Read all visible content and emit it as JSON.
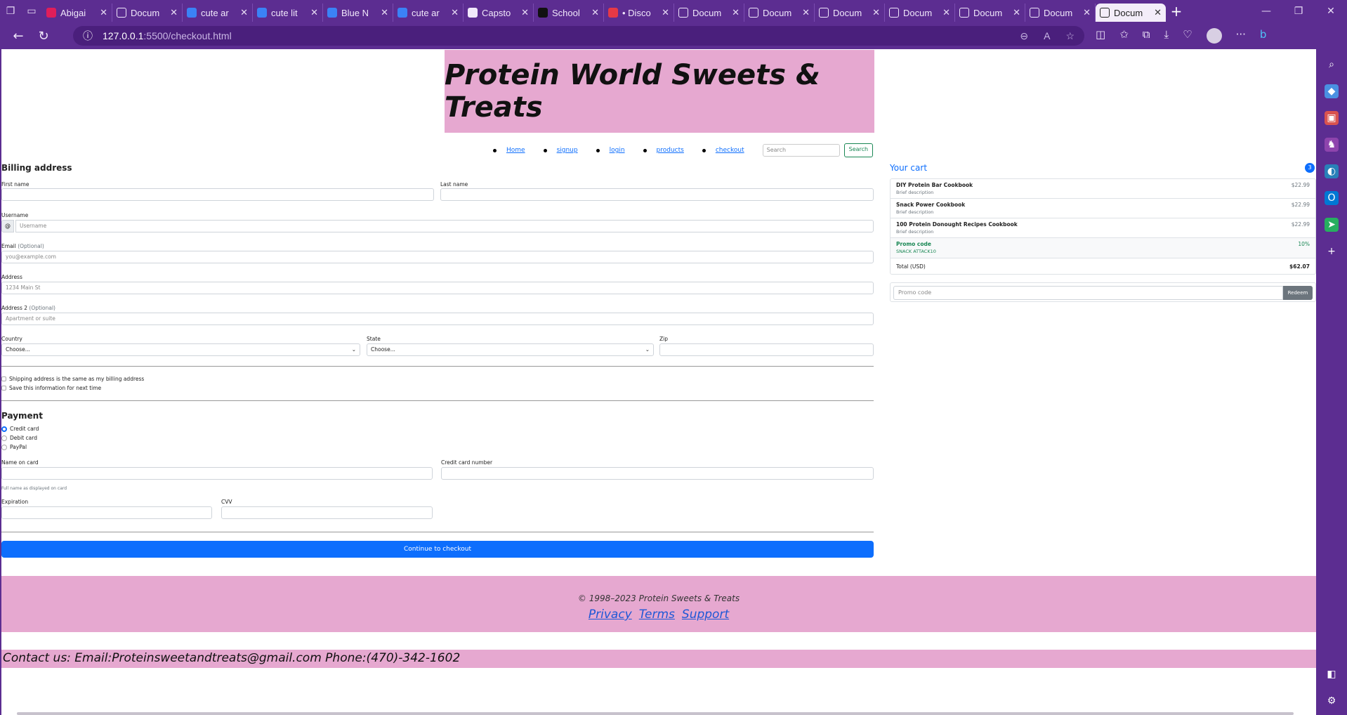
{
  "browser": {
    "tabs": [
      {
        "label": "Abigai",
        "icon": "slack-icon",
        "color": "#e01e5a"
      },
      {
        "label": "Docum",
        "icon": "document-icon",
        "color": "#f1e8fb"
      },
      {
        "label": "cute ar",
        "icon": "bing-search-icon",
        "color": "#3b82f6"
      },
      {
        "label": "cute lit",
        "icon": "bing-search-icon",
        "color": "#3b82f6"
      },
      {
        "label": "Blue N",
        "icon": "bing-search-icon",
        "color": "#3b82f6"
      },
      {
        "label": "cute ar",
        "icon": "bing-search-icon",
        "color": "#3b82f6"
      },
      {
        "label": "Capsto",
        "icon": "s-logo-icon",
        "color": "#f1e8fb"
      },
      {
        "label": "School",
        "icon": "school-icon",
        "color": "#111"
      },
      {
        "label": "• Disco",
        "icon": "discord-icon",
        "color": "#e63946"
      },
      {
        "label": "Docum",
        "icon": "document-icon",
        "color": "#f1e8fb"
      },
      {
        "label": "Docum",
        "icon": "document-icon",
        "color": "#f1e8fb"
      },
      {
        "label": "Docum",
        "icon": "document-icon",
        "color": "#f1e8fb"
      },
      {
        "label": "Docum",
        "icon": "document-icon",
        "color": "#f1e8fb"
      },
      {
        "label": "Docum",
        "icon": "document-icon",
        "color": "#f1e8fb"
      },
      {
        "label": "Docum",
        "icon": "document-icon",
        "color": "#f1e8fb"
      },
      {
        "label": "Docum",
        "icon": "document-icon",
        "color": "#222",
        "active": true
      }
    ],
    "url_host": "127.0.0.1",
    "url_path": ":5500/checkout.html"
  },
  "site": {
    "title": "Protein World Sweets & Treats",
    "nav": [
      "Home",
      "signup",
      "login",
      "products",
      "checkout"
    ],
    "search_placeholder": "Search",
    "search_button": "Search"
  },
  "billing": {
    "heading": "Billing address",
    "first_name_label": "First name",
    "last_name_label": "Last name",
    "username_label": "Username",
    "username_prefix": "@",
    "username_placeholder": "Username",
    "email_label": "Email",
    "email_optional": "(Optional)",
    "email_placeholder": "you@example.com",
    "address_label": "Address",
    "address_placeholder": "1234 Main St",
    "address2_label": "Address 2",
    "address2_optional": "(Optional)",
    "address2_placeholder": "Apartment or suite",
    "country_label": "Country",
    "country_value": "Choose...",
    "state_label": "State",
    "state_value": "Choose...",
    "zip_label": "Zip",
    "same_address": "Shipping address is the same as my billing address",
    "save_info": "Save this information for next time"
  },
  "payment": {
    "heading": "Payment",
    "methods": [
      "Credit card",
      "Debit card",
      "PayPal"
    ],
    "selected": "Credit card",
    "name_on_card_label": "Name on card",
    "name_hint": "Full name as displayed on card",
    "cc_number_label": "Credit card number",
    "expiration_label": "Expiration",
    "cvv_label": "CVV",
    "submit": "Continue to checkout"
  },
  "cart": {
    "title": "Your cart",
    "count": "3",
    "items": [
      {
        "name": "DIY Protein Bar Cookbook",
        "desc": "Brief description",
        "price": "$22.99"
      },
      {
        "name": "Snack Power Cookbook",
        "desc": "Brief description",
        "price": "$22.99"
      },
      {
        "name": "100 Protein Donought Recipes Cookbook",
        "desc": "Brief description",
        "price": "$22.99"
      }
    ],
    "promo": {
      "label": "Promo code",
      "code": "SNACK ATTACK10",
      "value": "10%"
    },
    "total_label": "Total (USD)",
    "total_value": "$62.07",
    "promo_placeholder": "Promo code",
    "redeem": "Redeem"
  },
  "footer": {
    "copyright": "© 1998–2023 Protein Sweets & Treats",
    "links": [
      "Privacy",
      "Terms",
      "Support"
    ],
    "contact": "Contact us: Email:Proteinsweetandtreats@gmail.com Phone:(470)-342-1602"
  }
}
